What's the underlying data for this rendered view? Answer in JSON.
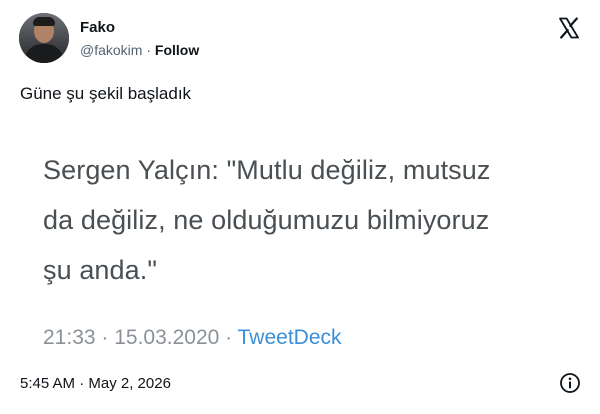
{
  "author": {
    "name": "Fako",
    "handle": "@fakokim",
    "separator": "·",
    "follow_label": "Follow"
  },
  "icons": {
    "brand": "x-logo",
    "info": "info-icon"
  },
  "tweet": {
    "text": "Güne şu şekil başladık",
    "timestamp": "5:45 AM · May 2, 2026"
  },
  "embedded_post": {
    "lines": [
      "Sergen Yalçın: \"Mutlu değiliz, mutsuz",
      "da değiliz, ne olduğumuzu bilmiyoruz",
      "şu anda.\""
    ],
    "time_date": "21:33 · 15.03.2020 ·",
    "source": "TweetDeck"
  },
  "colors": {
    "text": "#0f1419",
    "muted": "#536471",
    "quote_text": "#4a4f53",
    "quote_meta": "#8b9196",
    "link_blue": "#3b8fd9"
  }
}
